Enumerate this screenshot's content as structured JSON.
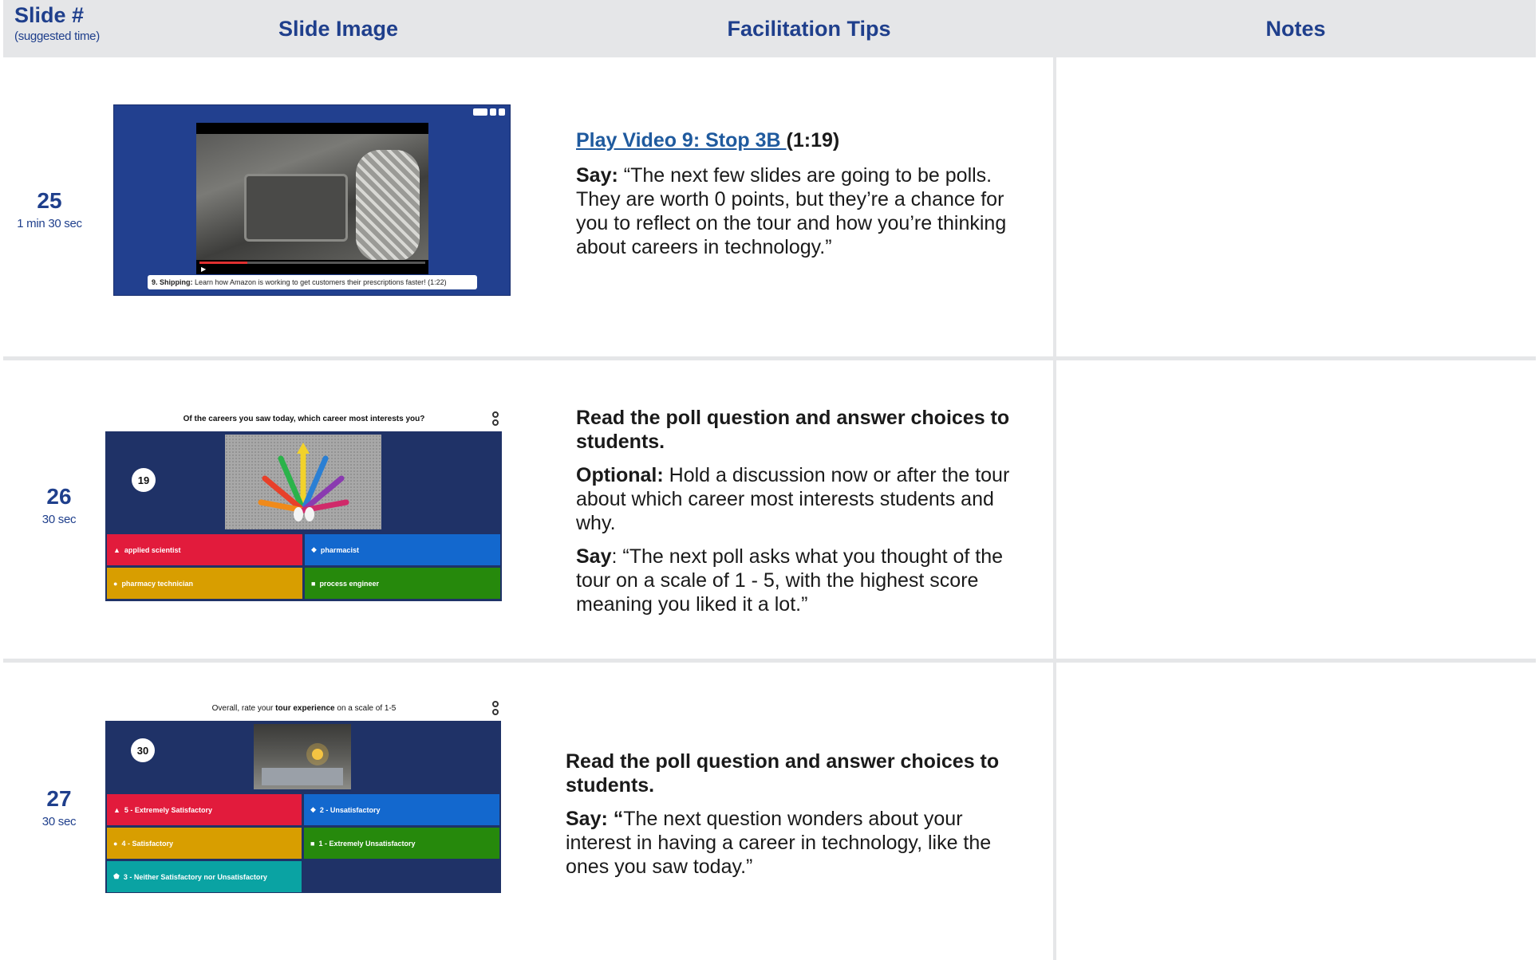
{
  "header": {
    "slide_title": "Slide #",
    "slide_subtitle": "(suggested time)",
    "image_title": "Slide Image",
    "tips_title": "Facilitation Tips",
    "notes_title": "Notes"
  },
  "rows": [
    {
      "slide_number": "25",
      "time": "1 min 30 sec",
      "thumbnail": {
        "caption_bold": "9. Shipping:",
        "caption_text": " Learn how Amazon is working to get customers their prescriptions faster! (1:22)"
      },
      "tips": {
        "link_text": "Play Video 9: Stop 3B ",
        "link_suffix": "(1:19)",
        "say_label": "Say:",
        "say_text": " “The next few slides are going to be polls. They are worth 0 points, but they’re a chance for you to reflect on the tour and how you’re thinking about careers in technology.”"
      }
    },
    {
      "slide_number": "26",
      "time": "30 sec",
      "thumbnail": {
        "question": "Of the careers you saw today, which career most interests you?",
        "timer": "19",
        "answers": [
          {
            "shape": "▲",
            "label": "applied scientist",
            "color": "#e21b3c"
          },
          {
            "shape": "◆",
            "label": "pharmacist",
            "color": "#1368ce"
          },
          {
            "shape": "●",
            "label": "pharmacy technician",
            "color": "#d89e00"
          },
          {
            "shape": "■",
            "label": "process engineer",
            "color": "#26890c"
          }
        ]
      },
      "tips": {
        "heading": "Read the poll question and answer choices to students.",
        "optional_label": "Optional:",
        "optional_text": " Hold a discussion now or after the tour about which career most interests students and why.",
        "say_label": "Say",
        "say_text": ": “The next poll asks what you thought of the tour on a scale of 1 - 5, with the highest score meaning you liked it a lot.”"
      }
    },
    {
      "slide_number": "27",
      "time": "30 sec",
      "thumbnail": {
        "question_pre": "Overall, rate your ",
        "question_bold": "tour experience",
        "question_post": " on a scale of 1-5",
        "timer": "30",
        "answers": [
          {
            "shape": "▲",
            "label": "5 - Extremely Satisfactory",
            "color": "#e21b3c"
          },
          {
            "shape": "◆",
            "label": "2 - Unsatisfactory",
            "color": "#1368ce"
          },
          {
            "shape": "●",
            "label": "4 - Satisfactory",
            "color": "#d89e00"
          },
          {
            "shape": "■",
            "label": "1 - Extremely Unsatisfactory",
            "color": "#26890c"
          },
          {
            "shape": "⬟",
            "label": "3 - Neither Satisfactory nor Unsatisfactory",
            "color": "#0aa3a3"
          }
        ]
      },
      "tips": {
        "heading": "Read the poll question and answer choices to students.",
        "say_label": "Say: “",
        "say_text": "The next question wonders about your interest in having a career in technology, like the ones you saw today.”"
      }
    }
  ]
}
